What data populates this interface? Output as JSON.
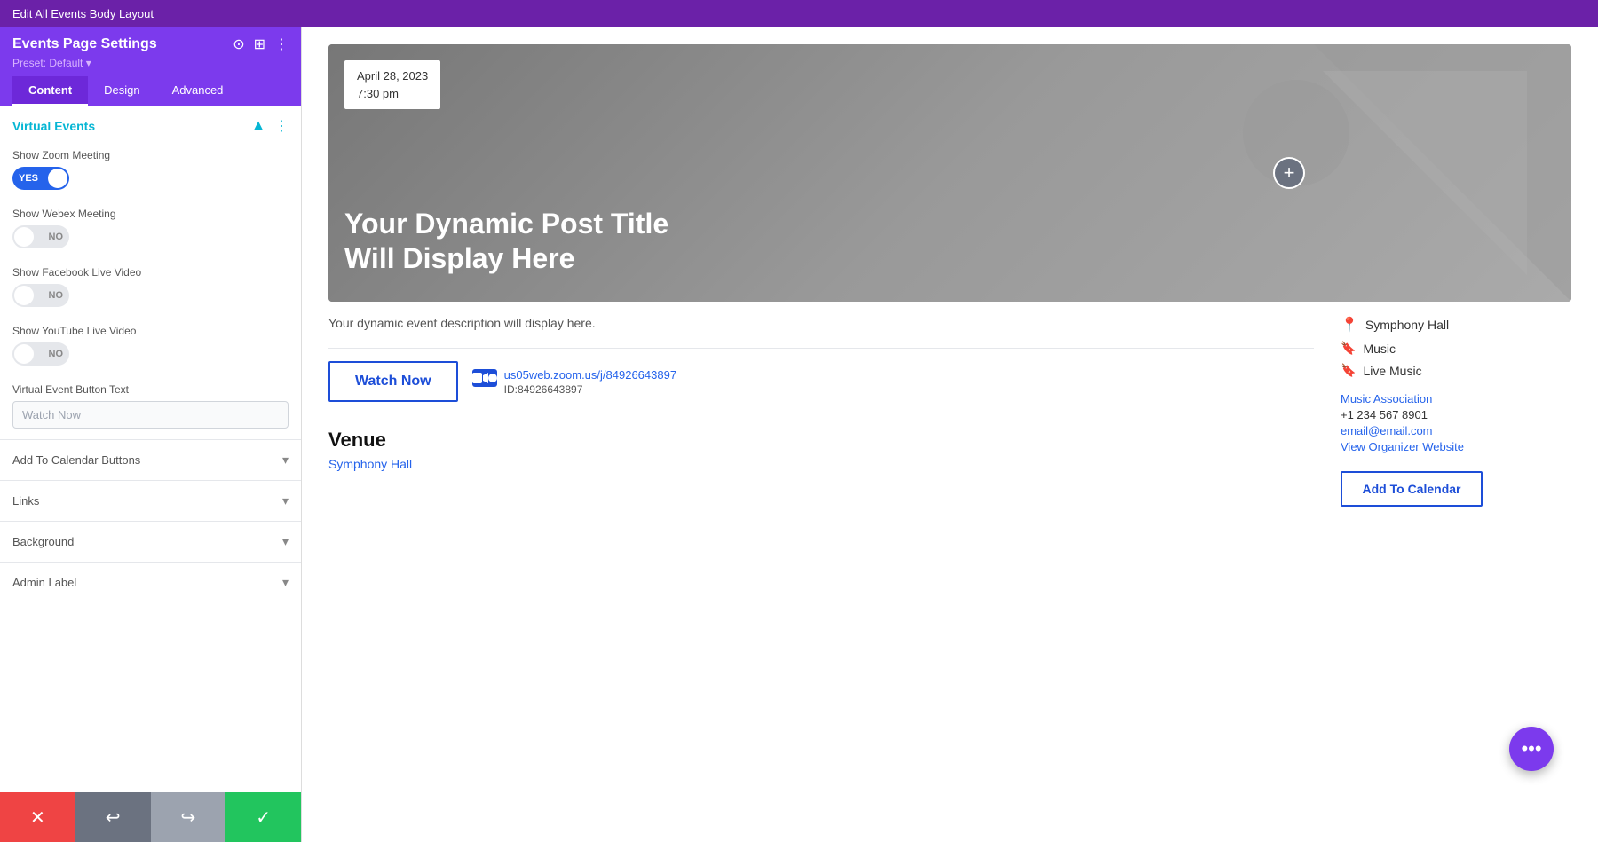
{
  "topbar": {
    "label": "Edit All Events Body Layout"
  },
  "sidebar": {
    "title": "Events Page Settings",
    "preset": "Preset: Default ▾",
    "tabs": [
      {
        "label": "Content",
        "active": true
      },
      {
        "label": "Design",
        "active": false
      },
      {
        "label": "Advanced",
        "active": false
      }
    ],
    "virtual_events_section": {
      "title": "Virtual Events",
      "fields": [
        {
          "label": "Show Zoom Meeting",
          "toggle_state": "YES",
          "on": true
        },
        {
          "label": "Show Webex Meeting",
          "toggle_state": "NO",
          "on": false
        },
        {
          "label": "Show Facebook Live Video",
          "toggle_state": "NO",
          "on": false
        },
        {
          "label": "Show YouTube Live Video",
          "toggle_state": "NO",
          "on": false
        }
      ],
      "button_text_field": {
        "label": "Virtual Event Button Text",
        "value": "Watch Now",
        "placeholder": "Watch Now"
      }
    },
    "collapsible_sections": [
      {
        "label": "Add To Calendar Buttons"
      },
      {
        "label": "Links"
      },
      {
        "label": "Background"
      },
      {
        "label": "Admin Label"
      }
    ]
  },
  "bottom_toolbar": {
    "buttons": [
      {
        "icon": "✕",
        "color": "red",
        "name": "cancel"
      },
      {
        "icon": "↩",
        "color": "gray",
        "name": "undo"
      },
      {
        "icon": "↪",
        "color": "light-gray",
        "name": "redo"
      },
      {
        "icon": "✓",
        "color": "green",
        "name": "save"
      }
    ]
  },
  "hero": {
    "date": "April 28, 2023",
    "time": "7:30 pm",
    "title": "Your Dynamic Post Title Will Display Here"
  },
  "event": {
    "description": "Your dynamic event description will display here.",
    "watch_button_label": "Watch Now",
    "zoom_link": "us05web.zoom.us/j/84926643897",
    "zoom_id_label": "ID:84926643897"
  },
  "side_info": {
    "venue": "Symphony Hall",
    "categories": [
      "Music",
      "Live Music"
    ],
    "organizer": {
      "name": "Music Association",
      "phone": "+1 234 567 8901",
      "email": "email@email.com",
      "website_label": "View Organizer Website"
    },
    "add_to_calendar_label": "Add To Calendar"
  },
  "venue_section": {
    "title": "Venue",
    "link_label": "Symphony Hall"
  },
  "fab": {
    "icon": "•••"
  }
}
